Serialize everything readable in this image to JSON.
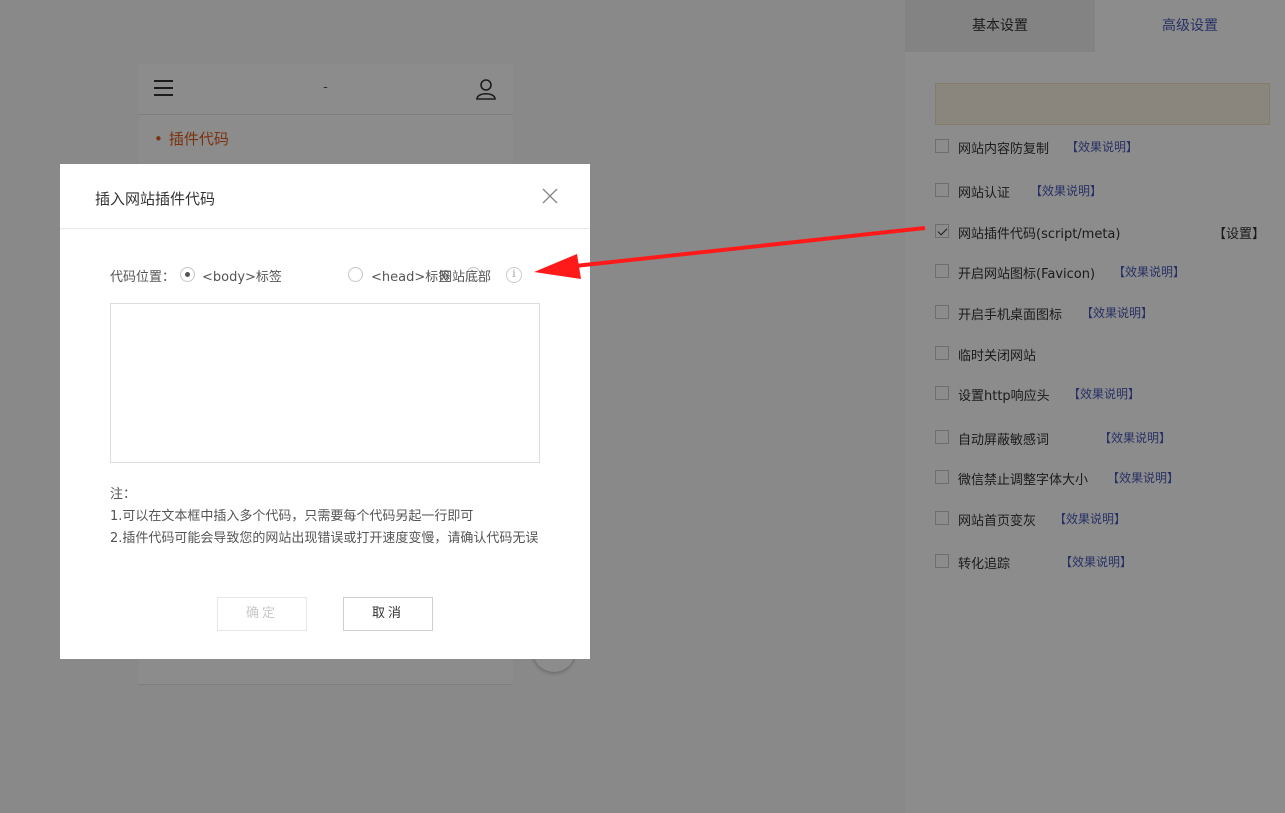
{
  "phone": {
    "title": "-",
    "plugin_item": "插件代码"
  },
  "panel": {
    "tabs": [
      {
        "label": "基本设置"
      },
      {
        "label": "高级设置"
      }
    ],
    "options": [
      {
        "label": "网站内容防复制",
        "link": "【效果说明】",
        "checked": false
      },
      {
        "label": "网站认证",
        "link": "【效果说明】",
        "checked": false
      },
      {
        "label": "网站插件代码(script/meta)",
        "action": "【设置】",
        "checked": true
      },
      {
        "label": "开启网站图标(Favicon)",
        "link": "【效果说明】",
        "checked": false
      },
      {
        "label": "开启手机桌面图标",
        "link": "【效果说明】",
        "checked": false
      },
      {
        "label": "临时关闭网站",
        "checked": false
      },
      {
        "label": "设置http响应头",
        "link": "【效果说明】",
        "checked": false
      },
      {
        "label": "自动屏蔽敏感词",
        "link": "【效果说明】",
        "checked": false
      },
      {
        "label": "微信禁止调整字体大小",
        "link": "【效果说明】",
        "checked": false
      },
      {
        "label": "网站首页变灰",
        "link": "【效果说明】",
        "checked": false
      },
      {
        "label": "转化追踪",
        "link": "【效果说明】",
        "checked": false
      }
    ]
  },
  "modal": {
    "title": "插入网站插件代码",
    "position_label": "代码位置：",
    "positions": [
      {
        "label": "<body>标签",
        "selected": true
      },
      {
        "label": "<head>标签",
        "selected": false
      },
      {
        "label": "网站底部",
        "selected": false
      }
    ],
    "info_icon": "i",
    "code_value": "",
    "notes": {
      "heading": "注：",
      "line1": "1.可以在文本框中插入多个代码，只需要每个代码另起一行即可",
      "line2": "2.插件代码可能会导致您的网站出现错误或打开速度变慢，请确认代码无误"
    },
    "confirm_label": "确定",
    "cancel_label": "取消"
  },
  "colors": {
    "accent": "#4a5ab8",
    "plugin_orange": "#e05b1c",
    "arrow_red": "#ff1a1a"
  }
}
